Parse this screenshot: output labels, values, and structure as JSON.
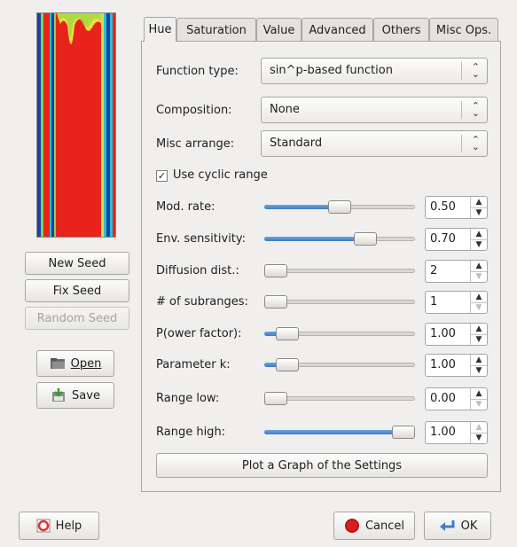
{
  "tabs": [
    {
      "label": "Hue",
      "active": true
    },
    {
      "label": "Saturation",
      "active": false
    },
    {
      "label": "Value",
      "active": false
    },
    {
      "label": "Advanced",
      "active": false
    },
    {
      "label": "Others",
      "active": false
    },
    {
      "label": "Misc Ops.",
      "active": false
    }
  ],
  "combos": [
    {
      "label": "Function type:",
      "value": "sin^p-based function"
    },
    {
      "label": "Composition:",
      "value": "None"
    },
    {
      "label": "Misc arrange:",
      "value": "Standard"
    }
  ],
  "checkbox": {
    "label": "Use cyclic range",
    "checked": true
  },
  "sliders": [
    {
      "label": "Mod. rate:",
      "value": "0.50",
      "fraction": 0.5
    },
    {
      "label": "Env. sensitivity:",
      "value": "0.70",
      "fraction": 0.7
    },
    {
      "label": "Diffusion dist.:",
      "value": "2",
      "fraction": 0.0
    },
    {
      "label": "# of subranges:",
      "value": "1",
      "fraction": 0.0
    },
    {
      "label": "P(ower factor):",
      "value": "1.00",
      "fraction": 0.09
    },
    {
      "label": "Parameter k:",
      "value": "1.00",
      "fraction": 0.09
    },
    {
      "label": "Range low:",
      "value": "0.00",
      "fraction": 0.0
    },
    {
      "label": "Range high:",
      "value": "1.00",
      "fraction": 1.0
    }
  ],
  "plot_button": "Plot a Graph of the Settings",
  "seed_buttons": {
    "new": "New Seed",
    "fix": "Fix Seed",
    "random": "Random Seed"
  },
  "file_buttons": {
    "open": "Open",
    "save": "Save"
  },
  "footer": {
    "help": "Help",
    "cancel": "Cancel",
    "ok": "OK"
  },
  "colors": {
    "preview_red": "#e8231c",
    "slider_fill": "#3b7cc4"
  }
}
